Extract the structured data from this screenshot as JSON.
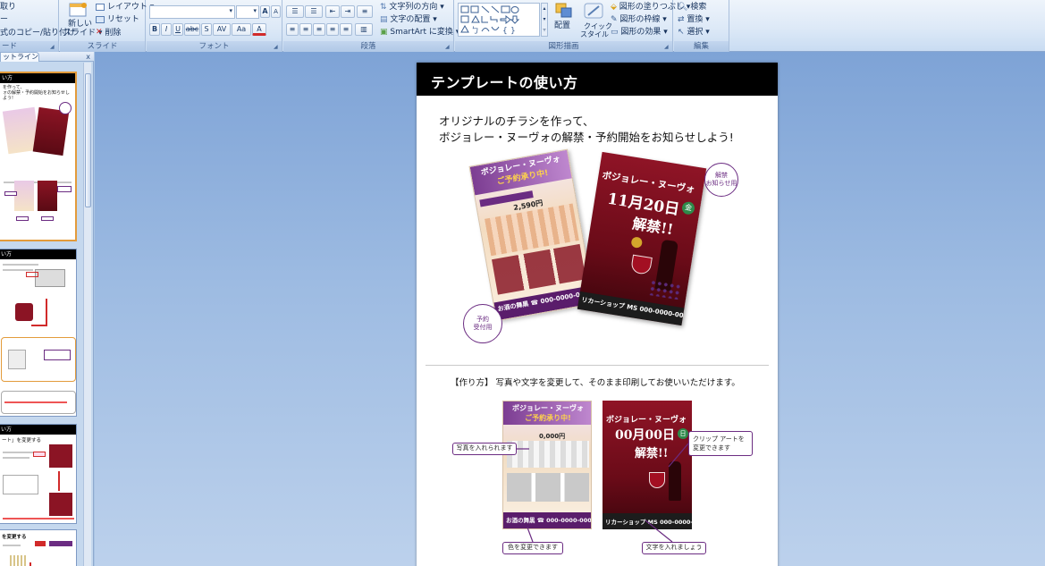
{
  "ribbon": {
    "clipboard": {
      "cut_label": "取り",
      "copy_label": "ー",
      "format_painter_label": "式のコピー/貼り付け",
      "group_label": "ード"
    },
    "slides": {
      "new_slide_label_line1": "新しい",
      "new_slide_label_line2": "スライド",
      "layout_label": "レイアウト",
      "reset_label": "リセット",
      "delete_label": "削除",
      "group_label": "スライド"
    },
    "font": {
      "font_name_value": "",
      "font_size_value": "",
      "grow_font": "A",
      "shrink_font": "A",
      "clear_format": "",
      "bold": "B",
      "italic": "I",
      "underline": "U",
      "strike": "abc",
      "shadow": "S",
      "spacing": "AV",
      "change_case": "Aa",
      "font_color": "A",
      "group_label": "フォント"
    },
    "paragraph": {
      "text_direction_label": "文字列の方向",
      "align_text_label": "文字の配置",
      "smartart_label": "SmartArt に変換",
      "group_label": "段落"
    },
    "drawing": {
      "arrange_label": "配置",
      "quick_styles_line1": "クイック",
      "quick_styles_line2": "スタイル",
      "shape_fill_label": "図形の塗りつぶし",
      "shape_outline_label": "図形の枠線",
      "shape_effects_label": "図形の効果",
      "group_label": "図形描画"
    },
    "editing": {
      "find_label": "検索",
      "replace_label": "置換",
      "select_label": "選択",
      "group_label": "編集"
    }
  },
  "pane": {
    "tab_outline_label": "ットライン",
    "close_label": "x",
    "slides": [
      {
        "title": "い方",
        "lines": [
          "を作って、",
          "ォの解禁・予約開始をお知らせしよう!"
        ],
        "selected": true
      },
      {
        "title": "い方",
        "lines": [],
        "selected": false
      },
      {
        "title": "い方",
        "lines": [],
        "selected": false
      },
      {
        "title": "ート」を変更する",
        "lines": [],
        "selected": false
      },
      {
        "title": "を変更する",
        "lines": [],
        "selected": false
      }
    ]
  },
  "slide": {
    "title": "テンプレートの使い方",
    "intro_line1": "オリジナルのチラシを作って、",
    "intro_line2": "ボジョレー・ヌーヴォの解禁・予約開始をお知らせしよう!",
    "tag_announce_line1": "解禁",
    "tag_announce_line2": "お知らせ用",
    "tag_order_line1": "予約",
    "tag_order_line2": "受付用",
    "howto": "【作り方】 写真や文字を変更して、そのまま印刷してお使いいただけます。",
    "flyer_order": {
      "heading_line1": "ボジョレー・ヌーヴォ",
      "heading_line2": "ご予約承り中!",
      "shop": "お酒の舞黒",
      "phone": "☎ 000-0000-0000",
      "price": "2,590円"
    },
    "flyer_release": {
      "heading": "ボジョレー・ヌーヴォ",
      "date": "11月20日",
      "weekday": "金",
      "release": "解禁!!",
      "shop": "リカーショップ MS",
      "phone": "000-0000-0000"
    },
    "flyer_order_small": {
      "heading_line1": "ボジョレー・ヌーヴォ",
      "heading_line2": "ご予約承り中!",
      "shop": "お酒の舞黒",
      "phone": "☎ 000-0000-0000",
      "price": "0,000円"
    },
    "flyer_release_small": {
      "heading": "ボジョレー・ヌーヴォ",
      "date": "00月00日",
      "weekday": "日",
      "release": "解禁!!",
      "shop": "リカーショップ MS",
      "phone": "000-0000-0000"
    },
    "callout_photo": "写真を入れられます",
    "callout_clipart_line1": "クリップ アートを",
    "callout_clipart_line2": "変更できます",
    "callout_color": "色を変更できます",
    "callout_text": "文字を入れましょう"
  },
  "colors": {
    "wine": "#7a1020",
    "purple": "#6b2c82",
    "flyer_top": "#f2d9a0"
  }
}
